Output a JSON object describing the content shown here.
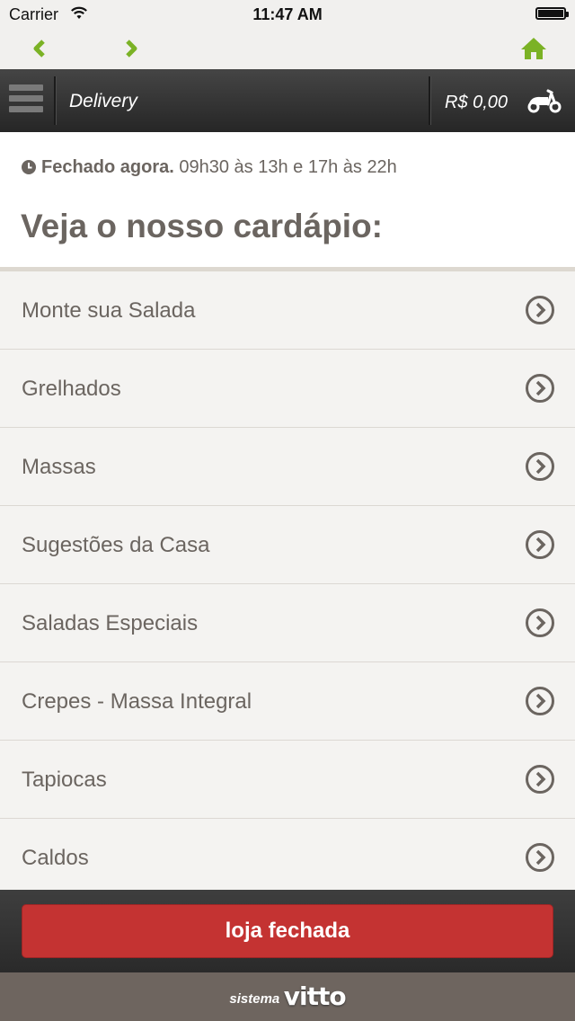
{
  "status_bar": {
    "carrier": "Carrier",
    "time": "11:47 AM"
  },
  "nav": {
    "back_icon": "chevron-left-icon",
    "forward_icon": "chevron-right-icon",
    "home_icon": "home-icon",
    "accent_color": "#7bb225"
  },
  "header": {
    "title": "Delivery",
    "cart_total": "R$ 0,00",
    "cart_icon": "scooter-icon"
  },
  "store": {
    "status": "Fechado agora.",
    "hours": "09h30 às 13h e 17h às 22h",
    "heading": "Veja o nosso cardápio:"
  },
  "menu": {
    "items": [
      {
        "label": "Monte sua Salada"
      },
      {
        "label": "Grelhados"
      },
      {
        "label": "Massas"
      },
      {
        "label": "Sugestões da Casa"
      },
      {
        "label": "Saladas Especiais"
      },
      {
        "label": "Crepes - Massa Integral"
      },
      {
        "label": "Tapiocas"
      },
      {
        "label": "Caldos"
      }
    ]
  },
  "footer": {
    "closed_button": "loja fechada",
    "brand_small": "sistema",
    "brand_big": "vitto",
    "button_color": "#c43332"
  }
}
